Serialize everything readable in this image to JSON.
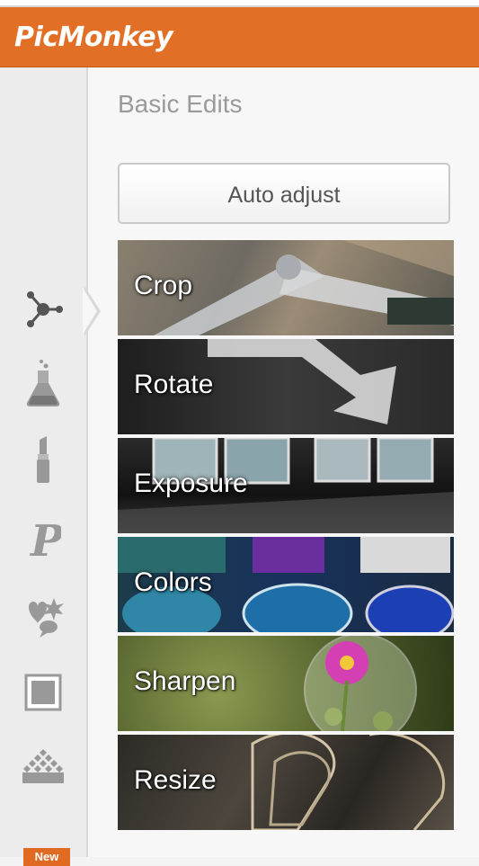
{
  "app": {
    "logo": "PicMonkey"
  },
  "panel": {
    "title": "Basic Edits",
    "auto_adjust_label": "Auto adjust"
  },
  "tools": [
    {
      "label": "Crop"
    },
    {
      "label": "Rotate"
    },
    {
      "label": "Exposure"
    },
    {
      "label": "Colors"
    },
    {
      "label": "Sharpen"
    },
    {
      "label": "Resize"
    }
  ],
  "sidebar": {
    "icons": [
      "basic-edits-icon",
      "effects-flask-icon",
      "touch-up-lipstick-icon",
      "text-p-icon",
      "overlays-icon",
      "frames-icon",
      "textures-icon"
    ],
    "new_badge": "New"
  },
  "colors": {
    "brand": "#e17026",
    "panel_bg": "#f7f7f7",
    "sidebar_bg": "#ececec"
  }
}
